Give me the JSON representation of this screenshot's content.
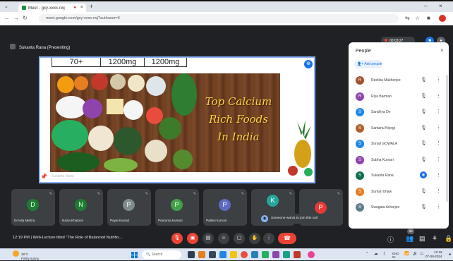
{
  "browser": {
    "tab_title": "Meet - gxy-xxxx-rwj",
    "new_tab": "+",
    "address": "meet.google.com/gxy-xxxx-rwj?authuser=0",
    "window_minimize": "–",
    "window_close": "×"
  },
  "meet": {
    "presenter_label": "Sukanta Rana (Presenting)",
    "recording_time": "00:03:27",
    "presentation": {
      "table_cells": [
        "70+",
        "1200mg",
        "1200mg"
      ],
      "slide_title_lines": [
        "Top Calcium",
        "Rich Foods",
        "In India"
      ],
      "screen_owner": "Sukanta Rana"
    },
    "people_panel": {
      "title": "People",
      "add_people": "Add people",
      "participants": [
        {
          "name": "Reetika Mukherjee",
          "initial": "R",
          "color": "#a0522d",
          "photo": true
        },
        {
          "name": "Riya Barman",
          "initial": "R",
          "color": "#8e44ad"
        },
        {
          "name": "Sandhya De",
          "initial": "S",
          "color": "#1e88e5"
        },
        {
          "name": "Santanu Niyogi",
          "initial": "S",
          "color": "#b05f2a",
          "photo": true
        },
        {
          "name": "Sonali GOWALA",
          "initial": "S",
          "color": "#1e88e5"
        },
        {
          "name": "Subha Kumari",
          "initial": "S",
          "color": "#8e44ad"
        },
        {
          "name": "Sukanta Rana",
          "initial": "S",
          "color": "#0b6e4f",
          "active": true
        },
        {
          "name": "Suman bhaw",
          "initial": "S",
          "color": "#e67e22"
        },
        {
          "name": "Swagata Acharjee",
          "initial": "S",
          "color": "#607d8b",
          "photo": true
        }
      ]
    },
    "tiles": [
      {
        "name": "DrArita Mishra",
        "initial": "D",
        "color": "#1e7d32"
      },
      {
        "name": "Nazia Khatoon",
        "initial": "N",
        "color": "#1e7d32"
      },
      {
        "name": "Payal Kumari",
        "initial": "P",
        "color": "#7f8c8d"
      },
      {
        "name": "Pranoma Kumari",
        "initial": "P",
        "color": "#43a047"
      },
      {
        "name": "Pallavi Kumari",
        "initial": "P",
        "color": "#5c6bc0"
      },
      {
        "name": "",
        "initial": "K",
        "color": "#26a69a"
      },
      {
        "name": "",
        "initial": "P",
        "color": "#e53935"
      }
    ],
    "toast": "Someone wants to join this call",
    "bottom_bar": {
      "meeting_info": "12:19 PM  |  Web-Lecture titled \"The Role of Balanced Nutritio...",
      "participant_count": "30"
    }
  },
  "taskbar": {
    "weather_temp": "29°C",
    "weather_desc": "Partly sunny",
    "search_placeholder": "Search",
    "tray_lang": "ENG",
    "tray_region": "IN",
    "time": "12:19",
    "date": "07-08-2024"
  }
}
